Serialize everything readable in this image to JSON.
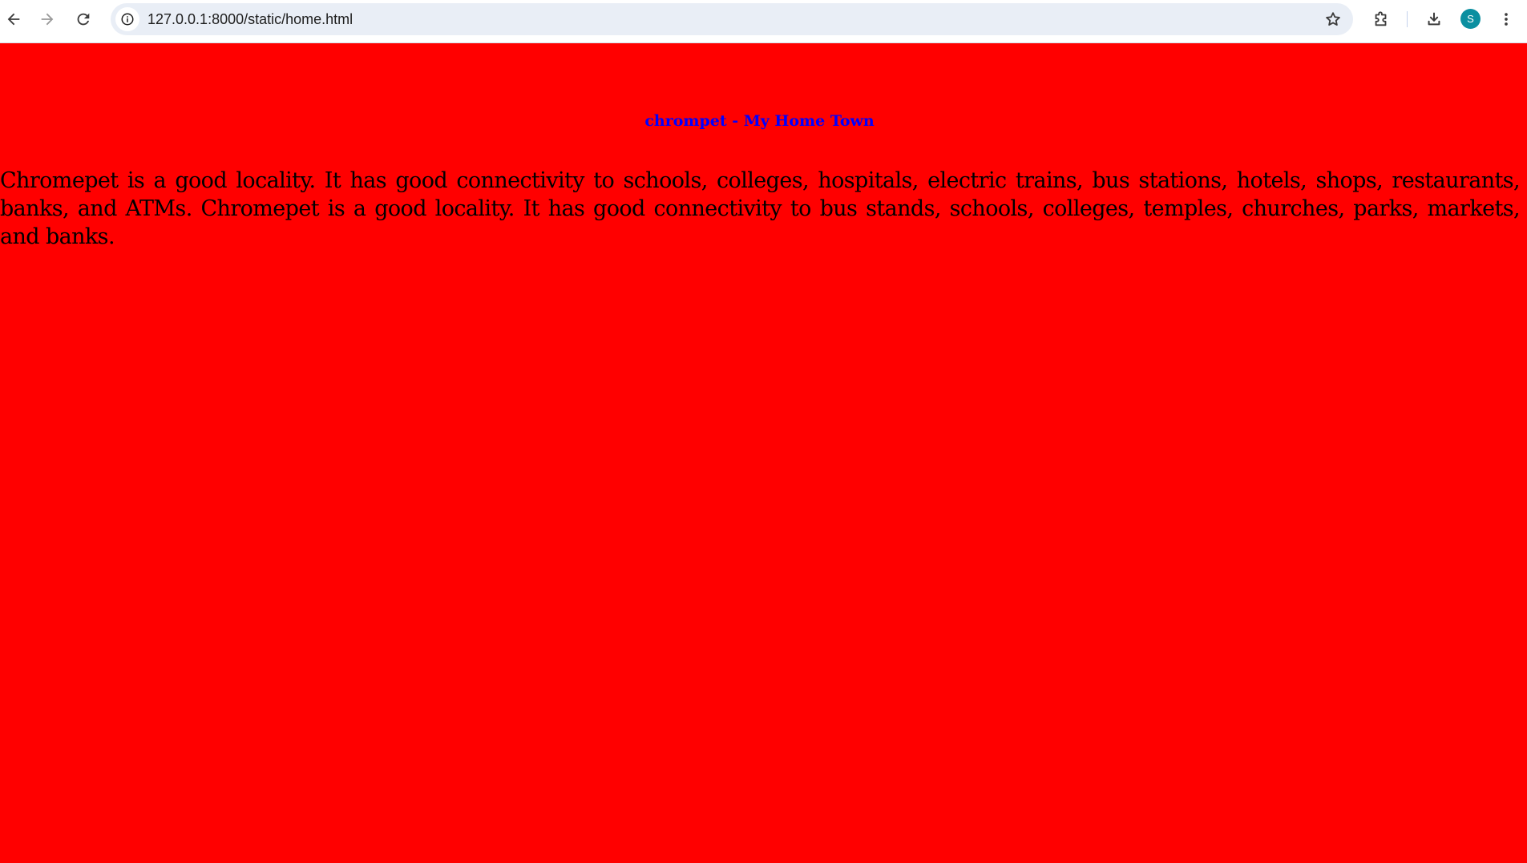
{
  "browser": {
    "url": "127.0.0.1:8000/static/home.html",
    "profile_initial": "S",
    "icons": [
      "back-arrow-icon",
      "forward-arrow-icon",
      "reload-icon",
      "info-icon",
      "star-icon",
      "extensions-icon",
      "download-icon",
      "kebab-menu-icon"
    ]
  },
  "page": {
    "heading": "chrompet - My Home Town",
    "paragraph": "Chromepet is a good locality. It has good connectivity to schools, colleges, hospitals, electric trains, bus stations, hotels, shops, restaurants, banks, and ATMs. Chromepet is a good locality. It has good connectivity to bus stands, schools, colleges, temples, churches, parks, markets, and banks.",
    "colors": {
      "background": "#ff0000",
      "heading": "#0000ff",
      "paragraph": "#000000"
    }
  }
}
